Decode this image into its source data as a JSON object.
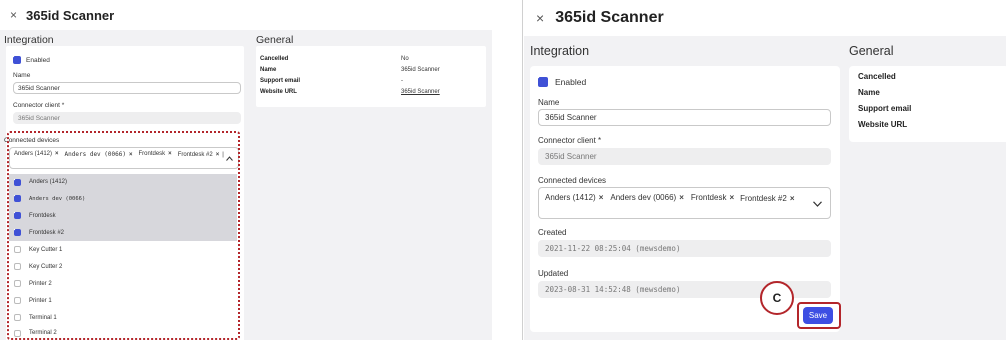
{
  "app": {
    "title": "365id Scanner",
    "close_glyph": "×"
  },
  "sections": {
    "integration": "Integration",
    "general": "General"
  },
  "form": {
    "enabled_label": "Enabled",
    "name_label": "Name",
    "name_value": "365id Scanner",
    "connector_label": "Connector client *",
    "connector_value": "365id Scanner",
    "devices_label": "Connected devices",
    "devices_selected": [
      "Anders (1412)",
      "Anders dev (0066)",
      "Frontdesk",
      "Frontdesk #2"
    ],
    "chip_remove_glyph": "×",
    "created_label": "Created",
    "created_value": "2021-11-22 08:25:04 (mewsdemo)",
    "updated_label": "Updated",
    "updated_value": "2023-08-31 14:52:48 (mewsdemo)",
    "save_label": "Save"
  },
  "device_options": [
    {
      "label": "Anders (1412)",
      "checked": true
    },
    {
      "label": "Anders dev (0066)",
      "checked": true
    },
    {
      "label": "Frontdesk",
      "checked": true
    },
    {
      "label": "Frontdesk #2",
      "checked": true
    },
    {
      "label": "Key Cutter 1",
      "checked": false
    },
    {
      "label": "Key Cutter 2",
      "checked": false
    },
    {
      "label": "Printer 2",
      "checked": false
    },
    {
      "label": "Printer 1",
      "checked": false
    },
    {
      "label": "Terminal 1",
      "checked": false
    },
    {
      "label": "Terminal 2",
      "checked": false
    }
  ],
  "general": {
    "cancelled_label": "Cancelled",
    "cancelled_value": "No",
    "name_label": "Name",
    "name_value": "365id Scanner",
    "support_label": "Support email",
    "support_value": "-",
    "website_label": "Website URL",
    "website_value": "365id Scanner"
  },
  "annotation": {
    "marker": "C"
  },
  "colors": {
    "accent": "#3d4ee3",
    "highlight": "#b3262b"
  }
}
